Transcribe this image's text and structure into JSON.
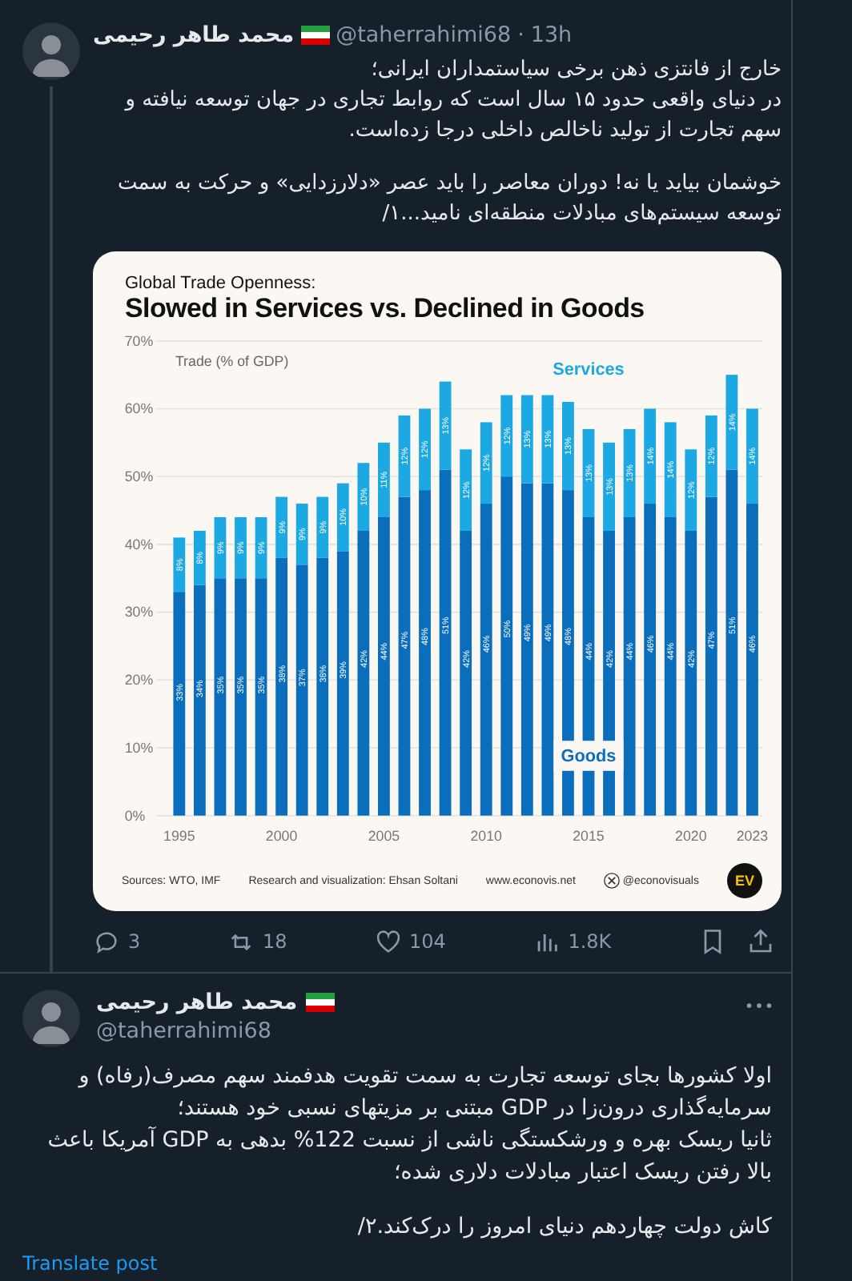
{
  "tweets": [
    {
      "author": {
        "name": "محمد طاهر رحیمی",
        "handle": "@taherrahimi68",
        "separator": "·",
        "time": "13h"
      },
      "text": [
        "خارج از فانتزی ذهن برخی سیاستمداران ایرانی؛\nدر دنیای واقعی حدود ۱۵ سال است که روابط تجاری در جهان توسعه نیافته و سهم تجارت از تولید ناخالص داخلی درجا زده‌است.",
        "خوشمان بیاید یا نه! دوران معاصر را باید عصر «دلارزدایی» و حرکت به سمت توسعه سیستم‌های مبادلات منطقه‌ای نامید...۱/"
      ],
      "infographic": {
        "subtitle": "Global Trade Openness:",
        "title": "Slowed in Services vs. Declined in Goods",
        "chart_data": {
          "type": "bar",
          "stacked": true,
          "orientation": "vertical",
          "ylabel": "Trade (% of GDP)",
          "x": [
            1995,
            1996,
            1997,
            1998,
            1999,
            2000,
            2001,
            2002,
            2003,
            2004,
            2005,
            2006,
            2007,
            2008,
            2009,
            2010,
            2011,
            2012,
            2013,
            2014,
            2015,
            2016,
            2017,
            2018,
            2019,
            2020,
            2021,
            2022,
            2023
          ],
          "series": [
            {
              "name": "Goods",
              "color": "#0a6ebd",
              "values": [
                33,
                34,
                35,
                35,
                35,
                38,
                37,
                38,
                39,
                42,
                44,
                47,
                48,
                51,
                42,
                46,
                50,
                49,
                49,
                48,
                44,
                42,
                44,
                46,
                44,
                42,
                47,
                51,
                46
              ],
              "value_labels": [
                "33%",
                "34%",
                "35%",
                "35%",
                "35%",
                "38%",
                "37%",
                "38%",
                "39%",
                "42%",
                "44%",
                "47%",
                "48%",
                "51%",
                "42%",
                "46%",
                "50%",
                "49%",
                "49%",
                "48%",
                "44%",
                "42%",
                "44%",
                "46%",
                "44%",
                "42%",
                "47%",
                "51%",
                "46%"
              ]
            },
            {
              "name": "Services",
              "color": "#1ca8e3",
              "values": [
                8,
                8,
                9,
                9,
                9,
                9,
                9,
                9,
                10,
                10,
                11,
                12,
                12,
                13,
                12,
                12,
                12,
                13,
                13,
                13,
                13,
                13,
                13,
                14,
                14,
                12,
                12,
                14,
                14
              ],
              "value_labels": [
                "8%",
                "8%",
                "9%",
                "9%",
                "9%",
                "9%",
                "9%",
                "9%",
                "10%",
                "10%",
                "11%",
                "12%",
                "12%",
                "13%",
                "12%",
                "12%",
                "12%",
                "13%",
                "13%",
                "13%",
                "13%",
                "13%",
                "13%",
                "14%",
                "14%",
                "12%",
                "12%",
                "14%",
                "14%"
              ]
            }
          ],
          "grid": true,
          "ylim": [
            0,
            70
          ],
          "yticks": [
            {
              "value": 0,
              "label": "0%"
            },
            {
              "value": 10,
              "label": "10%"
            },
            {
              "value": 20,
              "label": "20%"
            },
            {
              "value": 30,
              "label": "30%"
            },
            {
              "value": 40,
              "label": "40%"
            },
            {
              "value": 50,
              "label": "50%"
            },
            {
              "value": 60,
              "label": "60%"
            },
            {
              "value": 70,
              "label": "70%"
            }
          ],
          "xlim": [
            1995,
            2023
          ],
          "xticks": [
            1995,
            2000,
            2005,
            2010,
            2015,
            2020,
            2023
          ]
        },
        "footer": {
          "sources": "Sources: WTO, IMF",
          "credit": "Research and visualization: Ehsan Soltani",
          "website": "www.econovis.net",
          "social": "@econovisuals",
          "logo": "EV"
        }
      },
      "actions": {
        "replies": "3",
        "reposts": "18",
        "likes": "104",
        "views": "1.8K"
      }
    },
    {
      "author": {
        "name": "محمد طاهر رحیمی",
        "handle": "@taherrahimi68"
      },
      "text": [
        "اولا کشورها بجای توسعه تجارت به سمت تقویت هدفمند سهم مصرف(رفاه) و سرمایه‌گذاری درون‌زا در GDP مبتنی بر مزیتهای نسبی خود هستند؛\nثانیا ریسک بهره و ورشکستگی ناشی از نسبت 122% بدهی به GDP آمریکا باعث بالا رفتن ریسک اعتبار مبادلات دلاری شده؛",
        "کاش دولت چهاردهم دنیای امروز را درک‌کند.۲/"
      ],
      "translate": "Translate post"
    }
  ]
}
